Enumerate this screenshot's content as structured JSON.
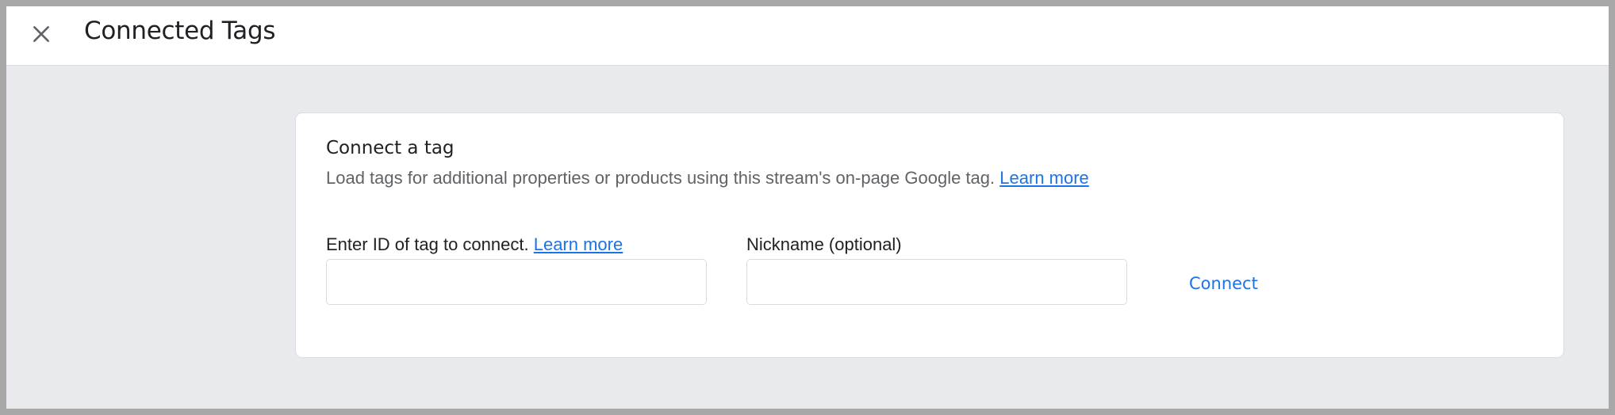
{
  "header": {
    "title": "Connected Tags",
    "close_icon": "close-icon"
  },
  "card": {
    "title": "Connect a tag",
    "description": "Load tags for additional properties or products using this stream's on-page Google tag.",
    "description_link": "Learn more",
    "tag_id_field": {
      "label": "Enter ID of tag to connect.",
      "link": "Learn more",
      "value": "",
      "placeholder": ""
    },
    "nickname_field": {
      "label": "Nickname (optional)",
      "value": "",
      "placeholder": ""
    },
    "connect_label": "Connect"
  },
  "colors": {
    "accent": "#1a73e8",
    "page_background": "#e8eaed",
    "text_primary": "#202124",
    "text_secondary": "#5f6368"
  }
}
